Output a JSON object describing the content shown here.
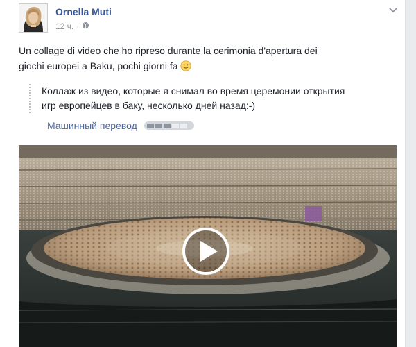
{
  "post": {
    "author": "Ornella Muti",
    "time": "12 ч.",
    "separator": "·",
    "privacy_icon": "globe-icon",
    "menu_icon": "chevron-down-icon",
    "text_lines": [
      "Un collage di video che ho ripreso durante la cerimonia d'apertura dei",
      "giochi europei a Baku, pochi giorni fa"
    ],
    "emoji": "smile-emoji-icon"
  },
  "translation": {
    "lines": [
      "Коллаж из видео, которые я снимал во время церемонии открытия",
      "игр европейцев в баку, несколько дней назад:-)"
    ],
    "label": "Машинный перевод",
    "rating_icon": "translation-rating-icon",
    "rating_fraction": 0.6
  },
  "video": {
    "content": "stadium-opening-ceremony-image",
    "play_icon": "play-icon"
  },
  "colors": {
    "link": "#365899",
    "meta": "#90949c",
    "text": "#1d2129"
  }
}
